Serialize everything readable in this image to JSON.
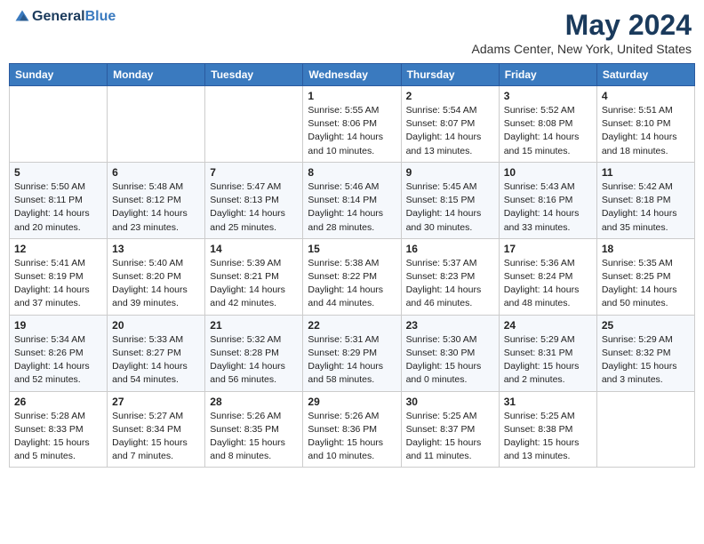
{
  "header": {
    "logo_general": "General",
    "logo_blue": "Blue",
    "month_year": "May 2024",
    "location": "Adams Center, New York, United States"
  },
  "days_of_week": [
    "Sunday",
    "Monday",
    "Tuesday",
    "Wednesday",
    "Thursday",
    "Friday",
    "Saturday"
  ],
  "weeks": [
    [
      {
        "day": "",
        "info": ""
      },
      {
        "day": "",
        "info": ""
      },
      {
        "day": "",
        "info": ""
      },
      {
        "day": "1",
        "info": "Sunrise: 5:55 AM\nSunset: 8:06 PM\nDaylight: 14 hours\nand 10 minutes."
      },
      {
        "day": "2",
        "info": "Sunrise: 5:54 AM\nSunset: 8:07 PM\nDaylight: 14 hours\nand 13 minutes."
      },
      {
        "day": "3",
        "info": "Sunrise: 5:52 AM\nSunset: 8:08 PM\nDaylight: 14 hours\nand 15 minutes."
      },
      {
        "day": "4",
        "info": "Sunrise: 5:51 AM\nSunset: 8:10 PM\nDaylight: 14 hours\nand 18 minutes."
      }
    ],
    [
      {
        "day": "5",
        "info": "Sunrise: 5:50 AM\nSunset: 8:11 PM\nDaylight: 14 hours\nand 20 minutes."
      },
      {
        "day": "6",
        "info": "Sunrise: 5:48 AM\nSunset: 8:12 PM\nDaylight: 14 hours\nand 23 minutes."
      },
      {
        "day": "7",
        "info": "Sunrise: 5:47 AM\nSunset: 8:13 PM\nDaylight: 14 hours\nand 25 minutes."
      },
      {
        "day": "8",
        "info": "Sunrise: 5:46 AM\nSunset: 8:14 PM\nDaylight: 14 hours\nand 28 minutes."
      },
      {
        "day": "9",
        "info": "Sunrise: 5:45 AM\nSunset: 8:15 PM\nDaylight: 14 hours\nand 30 minutes."
      },
      {
        "day": "10",
        "info": "Sunrise: 5:43 AM\nSunset: 8:16 PM\nDaylight: 14 hours\nand 33 minutes."
      },
      {
        "day": "11",
        "info": "Sunrise: 5:42 AM\nSunset: 8:18 PM\nDaylight: 14 hours\nand 35 minutes."
      }
    ],
    [
      {
        "day": "12",
        "info": "Sunrise: 5:41 AM\nSunset: 8:19 PM\nDaylight: 14 hours\nand 37 minutes."
      },
      {
        "day": "13",
        "info": "Sunrise: 5:40 AM\nSunset: 8:20 PM\nDaylight: 14 hours\nand 39 minutes."
      },
      {
        "day": "14",
        "info": "Sunrise: 5:39 AM\nSunset: 8:21 PM\nDaylight: 14 hours\nand 42 minutes."
      },
      {
        "day": "15",
        "info": "Sunrise: 5:38 AM\nSunset: 8:22 PM\nDaylight: 14 hours\nand 44 minutes."
      },
      {
        "day": "16",
        "info": "Sunrise: 5:37 AM\nSunset: 8:23 PM\nDaylight: 14 hours\nand 46 minutes."
      },
      {
        "day": "17",
        "info": "Sunrise: 5:36 AM\nSunset: 8:24 PM\nDaylight: 14 hours\nand 48 minutes."
      },
      {
        "day": "18",
        "info": "Sunrise: 5:35 AM\nSunset: 8:25 PM\nDaylight: 14 hours\nand 50 minutes."
      }
    ],
    [
      {
        "day": "19",
        "info": "Sunrise: 5:34 AM\nSunset: 8:26 PM\nDaylight: 14 hours\nand 52 minutes."
      },
      {
        "day": "20",
        "info": "Sunrise: 5:33 AM\nSunset: 8:27 PM\nDaylight: 14 hours\nand 54 minutes."
      },
      {
        "day": "21",
        "info": "Sunrise: 5:32 AM\nSunset: 8:28 PM\nDaylight: 14 hours\nand 56 minutes."
      },
      {
        "day": "22",
        "info": "Sunrise: 5:31 AM\nSunset: 8:29 PM\nDaylight: 14 hours\nand 58 minutes."
      },
      {
        "day": "23",
        "info": "Sunrise: 5:30 AM\nSunset: 8:30 PM\nDaylight: 15 hours\nand 0 minutes."
      },
      {
        "day": "24",
        "info": "Sunrise: 5:29 AM\nSunset: 8:31 PM\nDaylight: 15 hours\nand 2 minutes."
      },
      {
        "day": "25",
        "info": "Sunrise: 5:29 AM\nSunset: 8:32 PM\nDaylight: 15 hours\nand 3 minutes."
      }
    ],
    [
      {
        "day": "26",
        "info": "Sunrise: 5:28 AM\nSunset: 8:33 PM\nDaylight: 15 hours\nand 5 minutes."
      },
      {
        "day": "27",
        "info": "Sunrise: 5:27 AM\nSunset: 8:34 PM\nDaylight: 15 hours\nand 7 minutes."
      },
      {
        "day": "28",
        "info": "Sunrise: 5:26 AM\nSunset: 8:35 PM\nDaylight: 15 hours\nand 8 minutes."
      },
      {
        "day": "29",
        "info": "Sunrise: 5:26 AM\nSunset: 8:36 PM\nDaylight: 15 hours\nand 10 minutes."
      },
      {
        "day": "30",
        "info": "Sunrise: 5:25 AM\nSunset: 8:37 PM\nDaylight: 15 hours\nand 11 minutes."
      },
      {
        "day": "31",
        "info": "Sunrise: 5:25 AM\nSunset: 8:38 PM\nDaylight: 15 hours\nand 13 minutes."
      },
      {
        "day": "",
        "info": ""
      }
    ]
  ]
}
